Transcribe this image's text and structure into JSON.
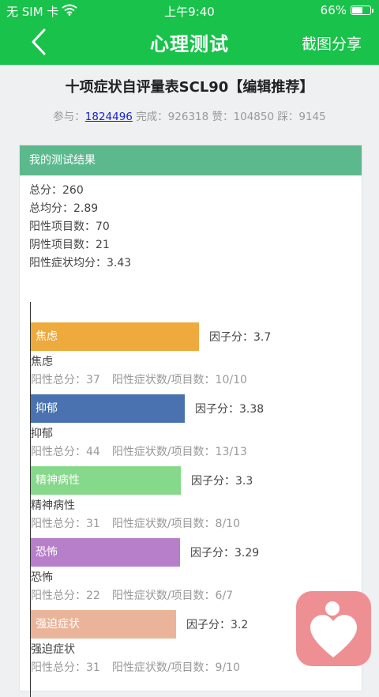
{
  "status_bar": {
    "carrier": "无 SIM 卡",
    "time": "上午9:40",
    "battery": "66%",
    "battery_level": 0.66
  },
  "nav": {
    "title": "心理测试",
    "share_label": "截图分享"
  },
  "test": {
    "title": "十项症状自评量表SCL90【编辑推荐】",
    "participants_label": "参与：",
    "participants": "1824496",
    "completed": "完成：926318",
    "likes": "赞：104850",
    "dislikes": "踩：9145"
  },
  "result": {
    "header": "我的测试结果",
    "summary": [
      "总分：260",
      "总均分：2.89",
      "阳性项目数：70",
      "阴性项目数：21",
      "阳性症状均分：3.43"
    ]
  },
  "chart_data": {
    "type": "bar",
    "orientation": "horizontal",
    "categories": [
      "焦虑",
      "抑郁",
      "精神病性",
      "恐怖",
      "强迫症状"
    ],
    "values": [
      3.7,
      3.38,
      3.3,
      3.29,
      3.2
    ],
    "score_label": "因子分：",
    "colors": [
      "#eeaa3c",
      "#4a72b0",
      "#86d98a",
      "#b77fc9",
      "#eab49a"
    ],
    "details": [
      {
        "positive_total": "阳性总分：37",
        "ratio": "阳性症状数/项目数：10/10"
      },
      {
        "positive_total": "阳性总分：44",
        "ratio": "阳性症状数/项目数：13/13"
      },
      {
        "positive_total": "阳性总分：31",
        "ratio": "阳性症状数/项目数：8/10"
      },
      {
        "positive_total": "阳性总分：22",
        "ratio": "阳性症状数/项目数：6/7"
      },
      {
        "positive_total": "阳性总分：31",
        "ratio": "阳性症状数/项目数：9/10"
      }
    ]
  },
  "floating_button": {
    "icon": "heart-person-icon",
    "color": "#ee8f93"
  }
}
